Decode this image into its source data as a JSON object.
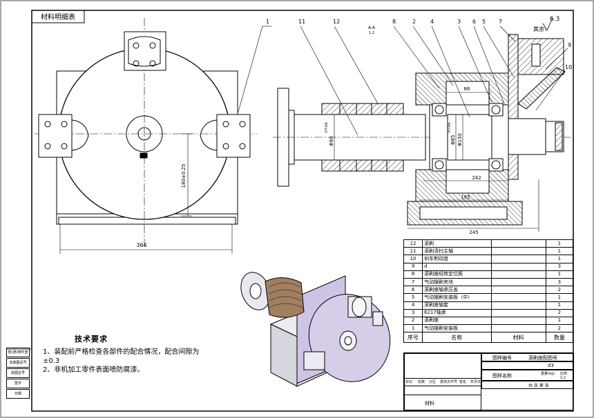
{
  "header_label": "材料明细表",
  "section_label": "A-A",
  "section_scale": "1:2",
  "roughness": "6.3",
  "roughness_prefix": "其余:",
  "balloons": [
    "1",
    "11",
    "12",
    "8",
    "2",
    "4",
    "3",
    "6",
    "5",
    "7",
    "9",
    "10"
  ],
  "dimensions": {
    "d364": "364",
    "d180": "180±0.25",
    "d86": "86",
    "d242": "242",
    "d185": "185",
    "d245": "245",
    "phi90": "Φ90",
    "phi85": "Φ85",
    "phi150": "Φ150",
    "fit1": "H7/k6",
    "fit2": "H7/k6"
  },
  "bom": {
    "rows": [
      {
        "no": "12",
        "name": "滚刷",
        "material": "",
        "qty": "1"
      },
      {
        "no": "11",
        "name": "滚刷清扫主轴",
        "material": "",
        "qty": "1"
      },
      {
        "no": "10",
        "name": "刹车制动盘",
        "material": "",
        "qty": "1"
      },
      {
        "no": "9",
        "name": "d",
        "material": "",
        "qty": "3"
      },
      {
        "no": "8",
        "name": "滚刷座经转定位板",
        "material": "",
        "qty": "1"
      },
      {
        "no": "7",
        "name": "气动摆刷夹块",
        "material": "",
        "qty": "3"
      },
      {
        "no": "6",
        "name": "滚刷座轴承压盖",
        "material": "",
        "qty": "2"
      },
      {
        "no": "5",
        "name": "气动摆刷安装板（中）",
        "material": "",
        "qty": "1"
      },
      {
        "no": "4",
        "name": "滚刷座轴套",
        "material": "",
        "qty": "1"
      },
      {
        "no": "3",
        "name": "6217轴承",
        "material": "",
        "qty": "2"
      },
      {
        "no": "2",
        "name": "滚刷座",
        "material": "",
        "qty": "1"
      },
      {
        "no": "1",
        "name": "气动摆刷安装板",
        "material": "",
        "qty": "2"
      }
    ],
    "header": {
      "no": "序号",
      "name": "名称",
      "material": "材料",
      "qty": "数量"
    }
  },
  "tech": {
    "title": "技术要求",
    "item1": "1、装配前严格检查各部件的配合情况，配合间隙为±0.3",
    "item2": "2、非机加工零件表面喷防腐漆。"
  },
  "title_block": {
    "drawing_no_label": "图样编号",
    "drawing_no_value": "滚刷座配图号",
    "drawing_name_label": "图样名称",
    "name_value": "d3",
    "weight_label": "重量(kg)",
    "scale_label": "比例",
    "scale_value": "1:2",
    "sheet_label": "共 张 第 张",
    "material_label": "材料",
    "rev_cells": [
      "标记",
      "处数",
      "分区",
      "更改文件号",
      "签名",
      "年月日"
    ]
  },
  "side_labels": [
    "借(通)用件登记",
    "旧底图总号",
    "底图总号",
    "签字",
    "日期"
  ]
}
